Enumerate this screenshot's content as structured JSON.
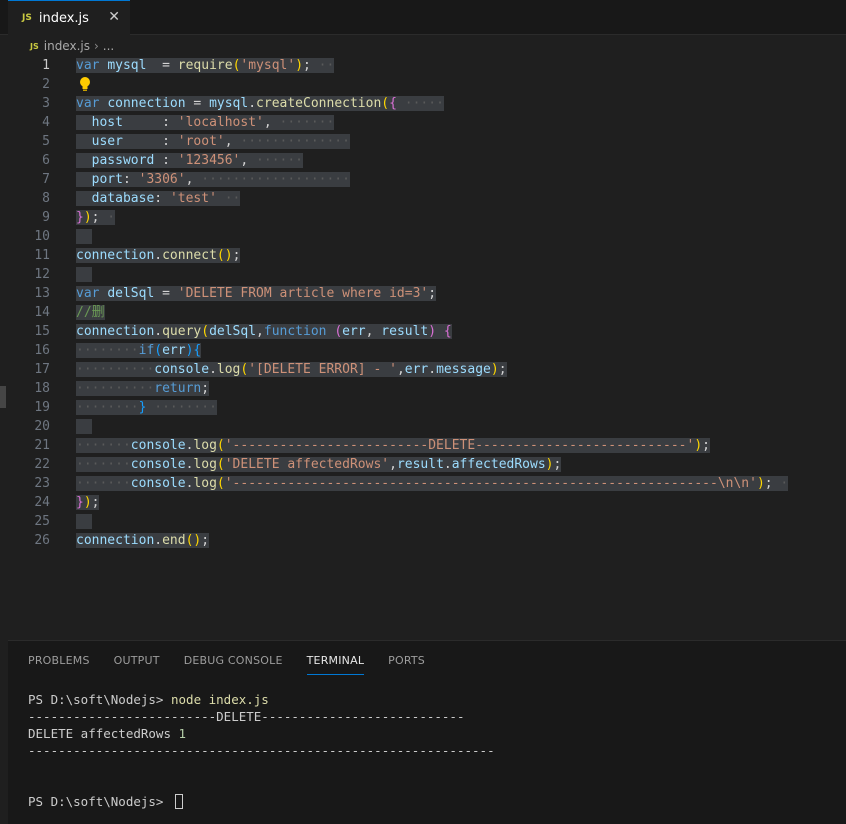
{
  "tab": {
    "badge": "JS",
    "label": "index.js",
    "close": "✕"
  },
  "breadcrumb": {
    "badge": "JS",
    "file": "index.js",
    "sep": "›",
    "more": "..."
  },
  "editor": {
    "active_line": 1,
    "lines": [
      {
        "n": 1,
        "tokens": [
          [
            "kw",
            "var"
          ],
          [
            "plain",
            " "
          ],
          [
            "var",
            "mysql"
          ],
          [
            "plain",
            "  = "
          ],
          [
            "fn",
            "require"
          ],
          [
            "br1",
            "("
          ],
          [
            "str",
            "'mysql'"
          ],
          [
            "br1",
            ")"
          ],
          [
            "plain",
            ";"
          ]
        ],
        "dots": 2
      },
      {
        "n": 2,
        "tokens": [],
        "bulb": true
      },
      {
        "n": 3,
        "tokens": [
          [
            "kw",
            "var"
          ],
          [
            "plain",
            " "
          ],
          [
            "var",
            "connection"
          ],
          [
            "plain",
            " = "
          ],
          [
            "var",
            "mysql"
          ],
          [
            "plain",
            "."
          ],
          [
            "fn",
            "createConnection"
          ],
          [
            "br1",
            "("
          ],
          [
            "br2",
            "{"
          ]
        ],
        "dots": 5
      },
      {
        "n": 4,
        "tokens": [
          [
            "plain",
            "  "
          ],
          [
            "var",
            "host"
          ],
          [
            "plain",
            "     : "
          ],
          [
            "str",
            "'localhost'"
          ],
          [
            "plain",
            ","
          ]
        ],
        "dots": 7
      },
      {
        "n": 5,
        "tokens": [
          [
            "plain",
            "  "
          ],
          [
            "var",
            "user"
          ],
          [
            "plain",
            "     : "
          ],
          [
            "str",
            "'root'"
          ],
          [
            "plain",
            ","
          ]
        ],
        "dots": 14
      },
      {
        "n": 6,
        "tokens": [
          [
            "plain",
            "  "
          ],
          [
            "var",
            "password"
          ],
          [
            "plain",
            " : "
          ],
          [
            "str",
            "'123456'"
          ],
          [
            "plain",
            ","
          ]
        ],
        "dots": 6
      },
      {
        "n": 7,
        "tokens": [
          [
            "plain",
            "  "
          ],
          [
            "var",
            "port"
          ],
          [
            "plain",
            ": "
          ],
          [
            "str",
            "'3306'"
          ],
          [
            "plain",
            ","
          ]
        ],
        "dots": 19
      },
      {
        "n": 8,
        "tokens": [
          [
            "plain",
            "  "
          ],
          [
            "var",
            "database"
          ],
          [
            "plain",
            ": "
          ],
          [
            "str",
            "'test'"
          ]
        ],
        "dots": 2
      },
      {
        "n": 9,
        "tokens": [
          [
            "br2",
            "}"
          ],
          [
            "br1",
            ")"
          ],
          [
            "plain",
            ";"
          ]
        ],
        "dots": 1
      },
      {
        "n": 10,
        "tokens": [
          [
            "plain",
            "  "
          ]
        ],
        "dots": 0
      },
      {
        "n": 11,
        "tokens": [
          [
            "var",
            "connection"
          ],
          [
            "plain",
            "."
          ],
          [
            "fn",
            "connect"
          ],
          [
            "br1",
            "()"
          ],
          [
            "plain",
            ";"
          ]
        ],
        "dots": 0
      },
      {
        "n": 12,
        "tokens": [
          [
            "plain",
            "  "
          ]
        ],
        "dots": 0
      },
      {
        "n": 13,
        "tokens": [
          [
            "kw",
            "var"
          ],
          [
            "plain",
            " "
          ],
          [
            "var",
            "delSql"
          ],
          [
            "plain",
            " = "
          ],
          [
            "str",
            "'DELETE FROM article where id=3'"
          ],
          [
            "plain",
            ";"
          ]
        ],
        "dots": 0
      },
      {
        "n": 14,
        "tokens": [
          [
            "cmt",
            "//删"
          ]
        ],
        "dots": 0
      },
      {
        "n": 15,
        "tokens": [
          [
            "var",
            "connection"
          ],
          [
            "plain",
            "."
          ],
          [
            "fn",
            "query"
          ],
          [
            "br1",
            "("
          ],
          [
            "var",
            "delSql"
          ],
          [
            "plain",
            ","
          ],
          [
            "kw",
            "function"
          ],
          [
            "plain",
            " "
          ],
          [
            "br2",
            "("
          ],
          [
            "var",
            "err"
          ],
          [
            "plain",
            ", "
          ],
          [
            "var",
            "result"
          ],
          [
            "br2",
            ")"
          ],
          [
            "plain",
            " "
          ],
          [
            "br2",
            "{"
          ]
        ],
        "dots": 0
      },
      {
        "n": 16,
        "tokens": [
          [
            "dot",
            "········"
          ],
          [
            "kw",
            "if"
          ],
          [
            "br3",
            "("
          ],
          [
            "var",
            "err"
          ],
          [
            "br3",
            ")"
          ],
          [
            "br3",
            "{"
          ]
        ],
        "dots": 0
      },
      {
        "n": 17,
        "tokens": [
          [
            "dot",
            "··········"
          ],
          [
            "var",
            "console"
          ],
          [
            "plain",
            "."
          ],
          [
            "fn",
            "log"
          ],
          [
            "br1",
            "("
          ],
          [
            "str",
            "'[DELETE ERROR] - '"
          ],
          [
            "plain",
            ","
          ],
          [
            "var",
            "err"
          ],
          [
            "plain",
            "."
          ],
          [
            "var",
            "message"
          ],
          [
            "br1",
            ")"
          ],
          [
            "plain",
            ";"
          ]
        ],
        "dots": 0
      },
      {
        "n": 18,
        "tokens": [
          [
            "dot",
            "··········"
          ],
          [
            "kw",
            "return"
          ],
          [
            "plain",
            ";"
          ]
        ],
        "dots": 0
      },
      {
        "n": 19,
        "tokens": [
          [
            "dot",
            "········"
          ],
          [
            "br3",
            "}"
          ]
        ],
        "dots": 8
      },
      {
        "n": 20,
        "tokens": [
          [
            "plain",
            "  "
          ]
        ],
        "dots": 0
      },
      {
        "n": 21,
        "tokens": [
          [
            "dot",
            "·······"
          ],
          [
            "var",
            "console"
          ],
          [
            "plain",
            "."
          ],
          [
            "fn",
            "log"
          ],
          [
            "br1",
            "("
          ],
          [
            "str",
            "'-------------------------DELETE---------------------------'"
          ],
          [
            "br1",
            ")"
          ],
          [
            "plain",
            ";"
          ]
        ],
        "dots": 0
      },
      {
        "n": 22,
        "tokens": [
          [
            "dot",
            "·······"
          ],
          [
            "var",
            "console"
          ],
          [
            "plain",
            "."
          ],
          [
            "fn",
            "log"
          ],
          [
            "br1",
            "("
          ],
          [
            "str",
            "'DELETE affectedRows'"
          ],
          [
            "plain",
            ","
          ],
          [
            "var",
            "result"
          ],
          [
            "plain",
            "."
          ],
          [
            "var",
            "affectedRows"
          ],
          [
            "br1",
            ")"
          ],
          [
            "plain",
            ";"
          ]
        ],
        "dots": 0
      },
      {
        "n": 23,
        "tokens": [
          [
            "dot",
            "·······"
          ],
          [
            "var",
            "console"
          ],
          [
            "plain",
            "."
          ],
          [
            "fn",
            "log"
          ],
          [
            "br1",
            "("
          ],
          [
            "str",
            "'--------------------------------------------------------------\\n\\n'"
          ],
          [
            "br1",
            ")"
          ],
          [
            "plain",
            ";"
          ]
        ],
        "dots": 1
      },
      {
        "n": 24,
        "tokens": [
          [
            "br2",
            "}"
          ],
          [
            "br1",
            ")"
          ],
          [
            "plain",
            ";"
          ]
        ],
        "dots": 0
      },
      {
        "n": 25,
        "tokens": [
          [
            "plain",
            "  "
          ]
        ],
        "dots": 0
      },
      {
        "n": 26,
        "tokens": [
          [
            "var",
            "connection"
          ],
          [
            "plain",
            "."
          ],
          [
            "fn",
            "end"
          ],
          [
            "br1",
            "()"
          ],
          [
            "plain",
            ";"
          ]
        ],
        "dots": 0
      }
    ]
  },
  "panel": {
    "tabs": [
      {
        "label": "PROBLEMS",
        "active": false
      },
      {
        "label": "OUTPUT",
        "active": false
      },
      {
        "label": "DEBUG CONSOLE",
        "active": false
      },
      {
        "label": "TERMINAL",
        "active": true
      },
      {
        "label": "PORTS",
        "active": false
      }
    ],
    "terminal": {
      "prompt1": "PS D:\\soft\\Nodejs> ",
      "command": "node index.js",
      "out1": "-------------------------DELETE---------------------------",
      "out2_label": "DELETE affectedRows ",
      "out2_value": "1",
      "out3": "--------------------------------------------------------------",
      "prompt2": "PS D:\\soft\\Nodejs> "
    }
  },
  "colors": {
    "accent": "#0078d4",
    "js_badge": "#cbcb41",
    "selection": "#3a3d41"
  }
}
